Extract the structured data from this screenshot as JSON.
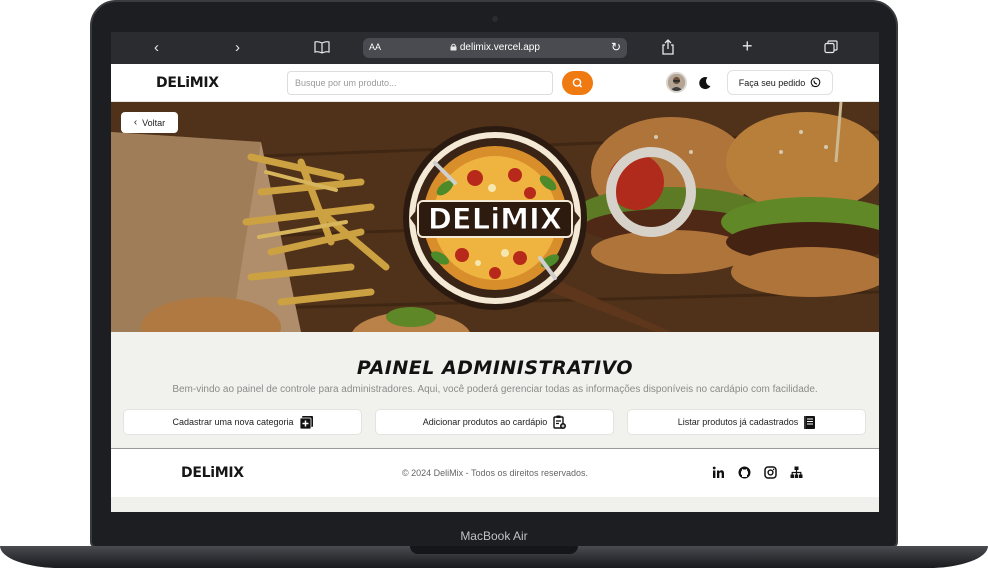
{
  "device": {
    "label": "MacBook Air"
  },
  "browser": {
    "back_icon": "chevron-left",
    "forward_icon": "chevron-right",
    "bookmarks_icon": "open-book",
    "text_size_label": "AA",
    "lock_icon": "lock",
    "address": "delimix.vercel.app",
    "reload_icon": "reload",
    "share_icon": "share",
    "new_tab_icon": "plus",
    "tabs_icon": "tabs"
  },
  "header": {
    "logo": "DELiMIX",
    "search_placeholder": "Busque por um produto...",
    "search_icon": "search",
    "theme_icon": "moon",
    "order_label": "Faça seu pedido",
    "whatsapp_icon": "whatsapp",
    "accent_color": "#f07a12"
  },
  "hero": {
    "back_label": "Voltar",
    "emblem_text": "DELiMIX"
  },
  "panel": {
    "title": "PAINEL ADMINISTRATIVO",
    "subtitle": "Bem-vindo ao painel de controle para administradores. Aqui, você poderá gerenciar todas as informações disponíveis no cardápio com facilidade.",
    "actions": [
      {
        "label": "Cadastrar uma nova categoria",
        "icon": "add-box"
      },
      {
        "label": "Adicionar produtos ao cardápio",
        "icon": "clipboard-add"
      },
      {
        "label": "Listar produtos já cadastrados",
        "icon": "list-book"
      }
    ]
  },
  "footer": {
    "logo": "DELiMIX",
    "copyright": "© 2024 DeliMix - Todos os direitos reservados.",
    "social": [
      "linkedin",
      "github",
      "instagram",
      "sitemap"
    ]
  }
}
